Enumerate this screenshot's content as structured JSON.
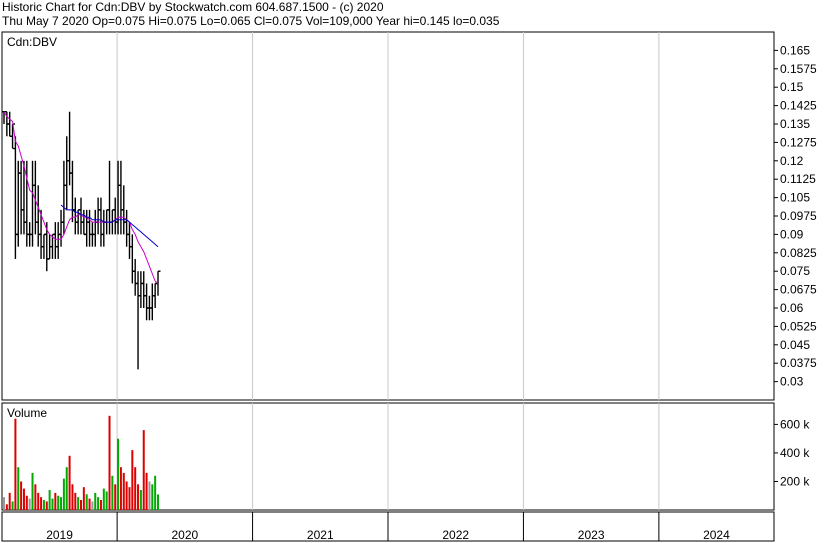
{
  "header": {
    "line1": "Historic Chart for Cdn:DBV by Stockwatch.com 604.687.1500 - (c) 2020",
    "line2": "Thu May  7 2020  Op=0.075  Hi=0.075  Lo=0.065  Cl=0.075  Vol=109,000  Year hi=0.145  lo=0.035"
  },
  "chart_data": {
    "type": "bar",
    "symbol_label": "Cdn:DBV",
    "volume_label": "Volume",
    "price_ylim": [
      0.0225,
      0.1725
    ],
    "price_ticks": [
      "0.165",
      "0.1575",
      "0.15",
      "0.1425",
      "0.135",
      "0.1275",
      "0.12",
      "0.1125",
      "0.105",
      "0.0975",
      "0.09",
      "0.0825",
      "0.075",
      "0.0675",
      "0.06",
      "0.0525",
      "0.045",
      "0.0375",
      "0.03"
    ],
    "volume_ylim": [
      0,
      750000
    ],
    "volume_ticks": [
      {
        "value": 600000,
        "label": "600 k"
      },
      {
        "value": 400000,
        "label": "400 k"
      },
      {
        "value": 200000,
        "label": "200 k"
      }
    ],
    "years": [
      "2019",
      "2020",
      "2021",
      "2022",
      "2023",
      "2024"
    ],
    "year_start_fraction": 0.0,
    "year_fraction_per_year": 1.0,
    "x_range_years": [
      2018.65,
      2024.35
    ],
    "ohlc": [
      {
        "o": 0.14,
        "h": 0.14,
        "l": 0.135,
        "c": 0.14
      },
      {
        "o": 0.14,
        "h": 0.14,
        "l": 0.13,
        "c": 0.135
      },
      {
        "o": 0.135,
        "h": 0.14,
        "l": 0.13,
        "c": 0.13
      },
      {
        "o": 0.13,
        "h": 0.135,
        "l": 0.125,
        "c": 0.135
      },
      {
        "o": 0.125,
        "h": 0.13,
        "l": 0.08,
        "c": 0.09
      },
      {
        "o": 0.09,
        "h": 0.12,
        "l": 0.085,
        "c": 0.115
      },
      {
        "o": 0.115,
        "h": 0.12,
        "l": 0.09,
        "c": 0.1
      },
      {
        "o": 0.1,
        "h": 0.12,
        "l": 0.09,
        "c": 0.095
      },
      {
        "o": 0.095,
        "h": 0.12,
        "l": 0.085,
        "c": 0.09
      },
      {
        "o": 0.09,
        "h": 0.095,
        "l": 0.085,
        "c": 0.09
      },
      {
        "o": 0.09,
        "h": 0.12,
        "l": 0.085,
        "c": 0.11
      },
      {
        "o": 0.11,
        "h": 0.12,
        "l": 0.09,
        "c": 0.095
      },
      {
        "o": 0.095,
        "h": 0.11,
        "l": 0.085,
        "c": 0.09
      },
      {
        "o": 0.09,
        "h": 0.1,
        "l": 0.08,
        "c": 0.085
      },
      {
        "o": 0.085,
        "h": 0.09,
        "l": 0.08,
        "c": 0.09
      },
      {
        "o": 0.09,
        "h": 0.095,
        "l": 0.075,
        "c": 0.08
      },
      {
        "o": 0.08,
        "h": 0.09,
        "l": 0.08,
        "c": 0.085
      },
      {
        "o": 0.085,
        "h": 0.09,
        "l": 0.08,
        "c": 0.09
      },
      {
        "o": 0.09,
        "h": 0.095,
        "l": 0.08,
        "c": 0.085
      },
      {
        "o": 0.085,
        "h": 0.095,
        "l": 0.08,
        "c": 0.09
      },
      {
        "o": 0.09,
        "h": 0.1,
        "l": 0.085,
        "c": 0.095
      },
      {
        "o": 0.095,
        "h": 0.12,
        "l": 0.09,
        "c": 0.11
      },
      {
        "o": 0.11,
        "h": 0.13,
        "l": 0.1,
        "c": 0.12
      },
      {
        "o": 0.12,
        "h": 0.14,
        "l": 0.11,
        "c": 0.115
      },
      {
        "o": 0.115,
        "h": 0.12,
        "l": 0.095,
        "c": 0.1
      },
      {
        "o": 0.1,
        "h": 0.105,
        "l": 0.09,
        "c": 0.095
      },
      {
        "o": 0.095,
        "h": 0.1,
        "l": 0.09,
        "c": 0.1
      },
      {
        "o": 0.1,
        "h": 0.105,
        "l": 0.09,
        "c": 0.095
      },
      {
        "o": 0.095,
        "h": 0.1,
        "l": 0.09,
        "c": 0.09
      },
      {
        "o": 0.09,
        "h": 0.1,
        "l": 0.085,
        "c": 0.095
      },
      {
        "o": 0.095,
        "h": 0.1,
        "l": 0.085,
        "c": 0.09
      },
      {
        "o": 0.09,
        "h": 0.095,
        "l": 0.085,
        "c": 0.09
      },
      {
        "o": 0.09,
        "h": 0.1,
        "l": 0.085,
        "c": 0.095
      },
      {
        "o": 0.095,
        "h": 0.105,
        "l": 0.09,
        "c": 0.1
      },
      {
        "o": 0.1,
        "h": 0.105,
        "l": 0.085,
        "c": 0.09
      },
      {
        "o": 0.09,
        "h": 0.1,
        "l": 0.085,
        "c": 0.095
      },
      {
        "o": 0.095,
        "h": 0.1,
        "l": 0.09,
        "c": 0.1
      },
      {
        "o": 0.1,
        "h": 0.12,
        "l": 0.09,
        "c": 0.095
      },
      {
        "o": 0.095,
        "h": 0.1,
        "l": 0.09,
        "c": 0.1
      },
      {
        "o": 0.1,
        "h": 0.105,
        "l": 0.09,
        "c": 0.095
      },
      {
        "o": 0.095,
        "h": 0.12,
        "l": 0.09,
        "c": 0.11
      },
      {
        "o": 0.11,
        "h": 0.12,
        "l": 0.09,
        "c": 0.1
      },
      {
        "o": 0.1,
        "h": 0.11,
        "l": 0.09,
        "c": 0.095
      },
      {
        "o": 0.095,
        "h": 0.1,
        "l": 0.085,
        "c": 0.09
      },
      {
        "o": 0.09,
        "h": 0.095,
        "l": 0.08,
        "c": 0.085
      },
      {
        "o": 0.085,
        "h": 0.09,
        "l": 0.07,
        "c": 0.075
      },
      {
        "o": 0.075,
        "h": 0.08,
        "l": 0.065,
        "c": 0.07
      },
      {
        "o": 0.07,
        "h": 0.075,
        "l": 0.035,
        "c": 0.065
      },
      {
        "o": 0.065,
        "h": 0.075,
        "l": 0.06,
        "c": 0.07
      },
      {
        "o": 0.07,
        "h": 0.075,
        "l": 0.06,
        "c": 0.065
      },
      {
        "o": 0.065,
        "h": 0.07,
        "l": 0.055,
        "c": 0.06
      },
      {
        "o": 0.06,
        "h": 0.065,
        "l": 0.055,
        "c": 0.06
      },
      {
        "o": 0.06,
        "h": 0.07,
        "l": 0.055,
        "c": 0.065
      },
      {
        "o": 0.065,
        "h": 0.07,
        "l": 0.06,
        "c": 0.07
      },
      {
        "o": 0.07,
        "h": 0.075,
        "l": 0.065,
        "c": 0.075
      }
    ],
    "volume": [
      90000,
      40000,
      120000,
      60000,
      640000,
      300000,
      200000,
      150000,
      100000,
      80000,
      260000,
      180000,
      120000,
      90000,
      70000,
      60000,
      140000,
      80000,
      120000,
      100000,
      90000,
      220000,
      300000,
      380000,
      180000,
      120000,
      90000,
      70000,
      160000,
      110000,
      80000,
      60000,
      120000,
      90000,
      70000,
      150000,
      130000,
      660000,
      240000,
      180000,
      500000,
      300000,
      260000,
      200000,
      160000,
      420000,
      300000,
      180000,
      140000,
      560000,
      260000,
      200000,
      180000,
      240000,
      109000
    ],
    "moving_averages": [
      {
        "name": "",
        "color": "#cc00cc",
        "values": [
          0.14,
          0.138,
          0.137,
          0.136,
          0.128,
          0.126,
          0.122,
          0.118,
          0.113,
          0.108,
          0.107,
          0.104,
          0.101,
          0.098,
          0.095,
          0.092,
          0.09,
          0.089,
          0.088,
          0.088,
          0.088,
          0.09,
          0.093,
          0.096,
          0.097,
          0.097,
          0.098,
          0.098,
          0.097,
          0.097,
          0.096,
          0.095,
          0.095,
          0.095,
          0.095,
          0.095,
          0.095,
          0.095,
          0.095,
          0.096,
          0.097,
          0.097,
          0.097,
          0.096,
          0.095,
          0.092,
          0.09,
          0.087,
          0.085,
          0.083,
          0.08,
          0.077,
          0.074,
          0.071,
          0.07
        ]
      },
      {
        "name": "",
        "color": "#0000cc",
        "values": [
          null,
          null,
          null,
          null,
          null,
          null,
          null,
          null,
          null,
          null,
          null,
          null,
          null,
          null,
          null,
          null,
          null,
          null,
          null,
          null,
          0.102,
          0.101,
          0.1,
          0.1,
          0.1,
          0.099,
          0.099,
          0.098,
          0.098,
          0.097,
          0.097,
          0.096,
          0.096,
          0.096,
          0.096,
          0.095,
          0.095,
          0.095,
          0.095,
          0.096,
          0.096,
          0.096,
          0.096,
          0.096,
          0.095,
          0.094,
          0.093,
          0.092,
          0.091,
          0.09,
          0.089,
          0.088,
          0.087,
          0.086,
          0.085
        ]
      }
    ]
  }
}
